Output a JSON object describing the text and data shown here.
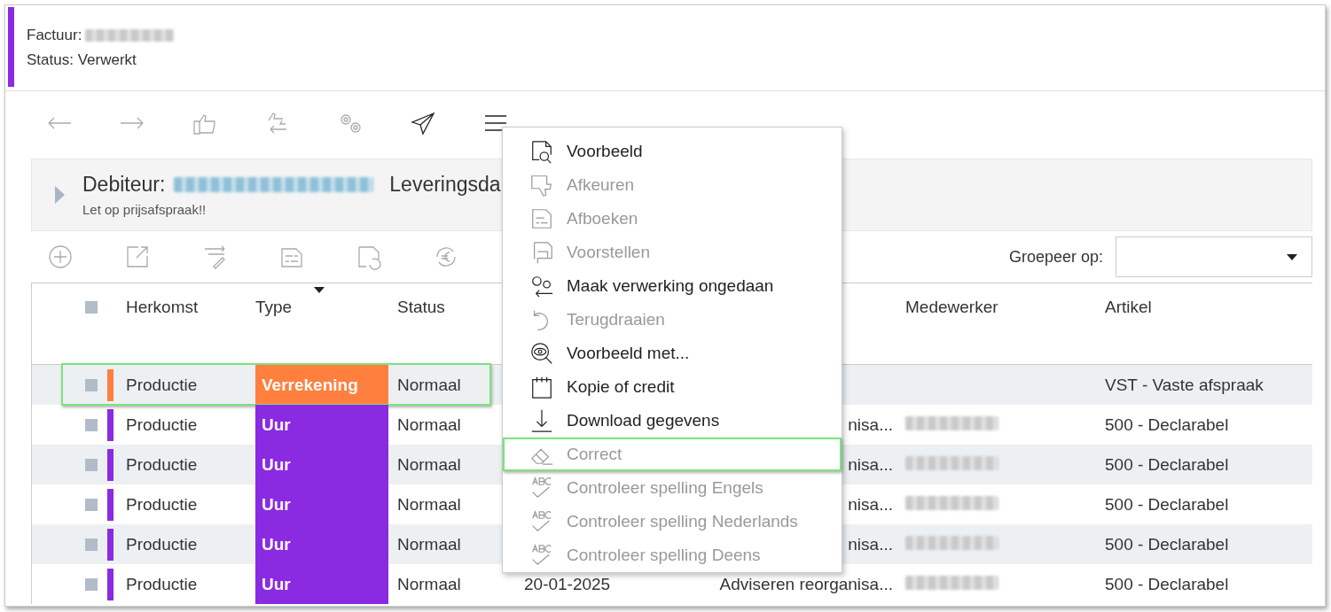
{
  "header": {
    "invoice_label": "Factuur:",
    "number_redacted": true,
    "status": "Status: Verwerkt"
  },
  "toolbar": [
    {
      "disabled": true
    },
    {
      "disabled": true
    },
    {
      "disabled": true
    },
    {
      "disabled": true
    },
    {
      "disabled": true
    },
    {
      "disabled": false
    },
    {
      "disabled": false
    }
  ],
  "debtor": {
    "label": "Debiteur:",
    "name_redacted": true,
    "delivery_label": "Leveringsda",
    "note": "Let op prijsafspraak!!",
    "expanded": false
  },
  "table_toolbar": [
    {
      "disabled": true
    },
    {
      "disabled": true
    },
    {
      "disabled": true
    },
    {
      "disabled": true
    },
    {
      "disabled": true
    },
    {
      "disabled": true
    }
  ],
  "group_by": {
    "label": "Groepeer op:"
  },
  "table": {
    "all_checked": false,
    "columns": [
      {
        "label": "Herkomst",
        "sorted": false
      },
      {
        "label": "Type",
        "sorted": true
      },
      {
        "label": "Status",
        "sorted": false
      },
      {
        "label": "Medewerker",
        "sorted": false
      },
      {
        "label": "Artikel",
        "sorted": false
      }
    ],
    "rows": [
      {
        "checked": false,
        "origin": "Productie",
        "type": "Verrekening",
        "color": "#ff7f3f",
        "status": "Normaal",
        "date": "",
        "description": "",
        "employee_redacted": false,
        "article": "VST - Vaste afspraak",
        "highlighted": true
      },
      {
        "checked": false,
        "origin": "Productie",
        "type": "Uur",
        "color": "#8a2be2",
        "status": "Normaal",
        "date": "",
        "description": "nisa...",
        "employee_redacted": true,
        "article": "500 - Declarabel",
        "highlighted": false
      },
      {
        "checked": false,
        "origin": "Productie",
        "type": "Uur",
        "color": "#8a2be2",
        "status": "Normaal",
        "date": "",
        "description": "nisa...",
        "employee_redacted": true,
        "article": "500 - Declarabel",
        "highlighted": false
      },
      {
        "checked": false,
        "origin": "Productie",
        "type": "Uur",
        "color": "#8a2be2",
        "status": "Normaal",
        "date": "",
        "description": "nisa...",
        "employee_redacted": true,
        "article": "500 - Declarabel",
        "highlighted": false
      },
      {
        "checked": false,
        "origin": "Productie",
        "type": "Uur",
        "color": "#8a2be2",
        "status": "Normaal",
        "date": "",
        "description": "nisa...",
        "employee_redacted": true,
        "article": "500 - Declarabel",
        "highlighted": false
      },
      {
        "checked": false,
        "origin": "Productie",
        "type": "Uur",
        "color": "#8a2be2",
        "status": "Normaal",
        "date": "20-01-2025",
        "description": "Adviseren reorganisa...",
        "employee_redacted": true,
        "article": "500 - Declarabel",
        "highlighted": false
      }
    ]
  },
  "menu": {
    "items": [
      {
        "label": "Voorbeeld",
        "disabled": false,
        "highlighted": false
      },
      {
        "label": "Afkeuren",
        "disabled": true,
        "highlighted": false
      },
      {
        "label": "Afboeken",
        "disabled": true,
        "highlighted": false
      },
      {
        "label": "Voorstellen",
        "disabled": true,
        "highlighted": false
      },
      {
        "label": "Maak verwerking ongedaan",
        "disabled": false,
        "highlighted": false
      },
      {
        "label": "Terugdraaien",
        "disabled": true,
        "highlighted": false
      },
      {
        "label": "Voorbeeld met...",
        "disabled": false,
        "highlighted": false
      },
      {
        "label": "Kopie of credit",
        "disabled": false,
        "highlighted": false
      },
      {
        "label": "Download gegevens",
        "disabled": false,
        "highlighted": false
      },
      {
        "label": "Correct",
        "disabled": true,
        "highlighted": true
      },
      {
        "label": "Controleer spelling Engels",
        "disabled": true,
        "highlighted": false
      },
      {
        "label": "Controleer spelling Nederlands",
        "disabled": true,
        "highlighted": false
      },
      {
        "label": "Controleer spelling Deens",
        "disabled": true,
        "highlighted": false
      }
    ]
  }
}
